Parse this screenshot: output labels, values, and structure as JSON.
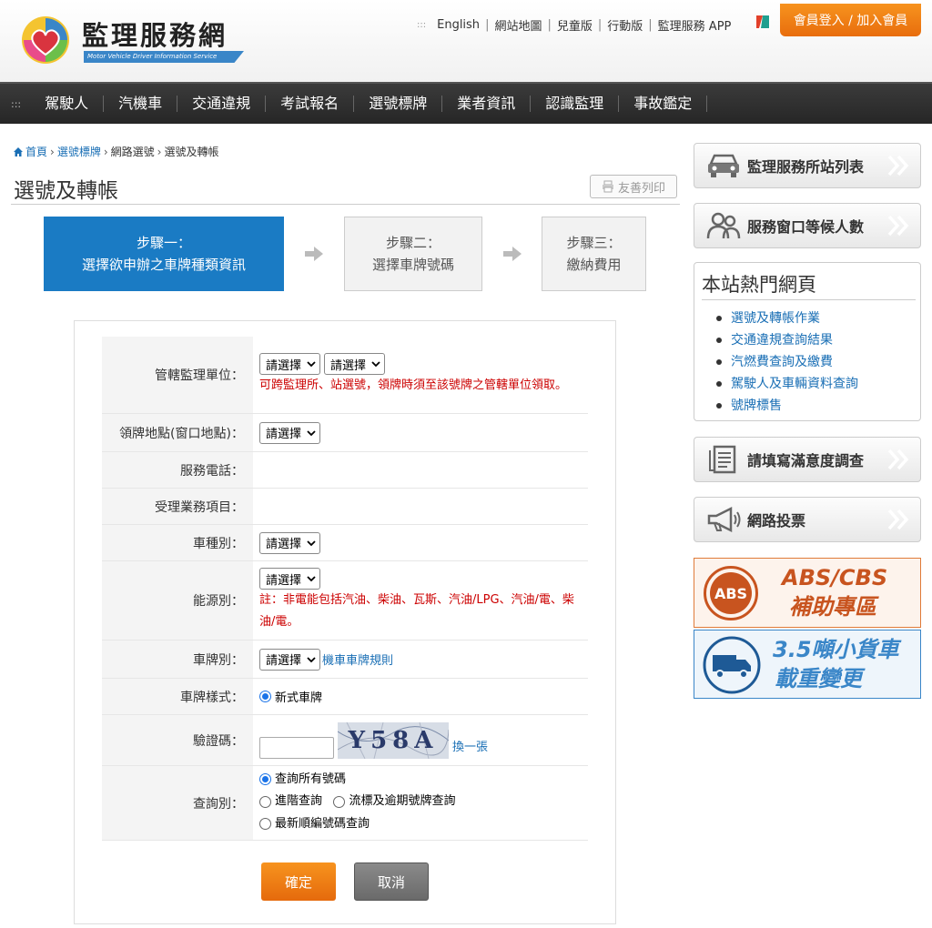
{
  "header": {
    "logo_title": "監理服務網",
    "logo_subtitle": "Motor Vehicle Driver Information Service",
    "top_links": [
      "English",
      "網站地圖",
      "兒童版",
      "行動版",
      "監理服務 APP"
    ],
    "member_button": "會員登入 / 加入會員"
  },
  "nav": {
    "items": [
      "駕駛人",
      "汽機車",
      "交通違規",
      "考試報名",
      "選號標牌",
      "業者資訊",
      "認識監理",
      "事故鑑定"
    ]
  },
  "breadcrumb": {
    "home": "首頁",
    "level1": "選號標牌",
    "level2": "網路選號",
    "current": "選號及轉帳"
  },
  "page": {
    "title": "選號及轉帳",
    "print_button": "友善列印"
  },
  "steps": [
    {
      "line1": "步驟一：",
      "line2": "選擇欲申辦之車牌種類資訊"
    },
    {
      "line1": "步驟二：",
      "line2": "選擇車牌號碼"
    },
    {
      "line1": "步驟三：",
      "line2": "繳納費用"
    }
  ],
  "form": {
    "jurisdiction": {
      "label": "管轄監理單位：",
      "select1": "請選擇",
      "select2": "請選擇",
      "note": "可跨監理所、站選號，領牌時須至該號牌之管轄單位領取。"
    },
    "pickup_location": {
      "label": "領牌地點(窗口地點)：",
      "select": "請選擇"
    },
    "service_phone": {
      "label": "服務電話："
    },
    "service_items": {
      "label": "受理業務項目："
    },
    "vehicle_type": {
      "label": "車種別：",
      "select": "請選擇"
    },
    "energy_type": {
      "label": "能源別：",
      "select": "請選擇",
      "note": "註：非電能包括汽油、柴油、瓦斯、汽油/LPG、汽油/電、柴油/電。"
    },
    "plate_type": {
      "label": "車牌別：",
      "select": "請選擇",
      "link": "機車車牌規則"
    },
    "plate_style": {
      "label": "車牌樣式：",
      "option": "新式車牌"
    },
    "captcha": {
      "label": "驗證碼：",
      "code": "Y58A",
      "refresh": "換一張"
    },
    "query_type": {
      "label": "查詢別：",
      "options": [
        "查詢所有號碼",
        "進階查詢",
        "流標及逾期號牌查詢",
        "最新順編號碼查詢"
      ]
    },
    "confirm_button": "確定",
    "cancel_button": "取消"
  },
  "sidebar": {
    "station_list": "監理服務所站列表",
    "queue": "服務窗口等候人數",
    "hot_title": "本站熱門網頁",
    "hot_links": [
      "選號及轉帳作業",
      "交通違規查詢結果",
      "汽燃費查詢及繳費",
      "駕駛人及車輛資料查詢",
      "號牌標售"
    ],
    "survey": "請填寫滿意度調查",
    "vote": "網路投票",
    "abs_badge": "ABS",
    "abs_line1": "ABS/CBS",
    "abs_line2": "補助專區",
    "truck_line1": "3.5噸小貨車",
    "truck_line2": "載重變更"
  },
  "colors": {
    "accent_orange": "#f7931e",
    "step_blue": "#1a7bc4",
    "nav_dark": "#2e2e2e",
    "link_blue": "#1a6fb5",
    "note_red": "#cc0000"
  }
}
